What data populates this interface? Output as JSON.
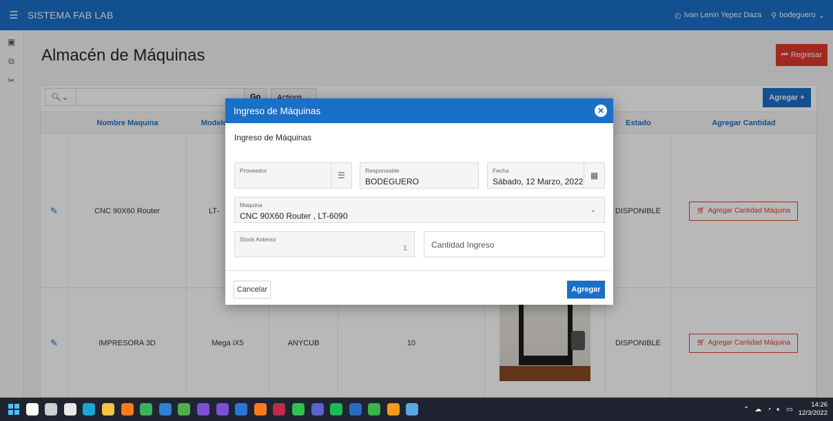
{
  "app": {
    "title": "SISTEMA FAB LAB",
    "user_full": "Ivan Lenin Yepez Daza",
    "user_name": "bodeguero"
  },
  "page": {
    "title": "Almacén de Máquinas",
    "back_label": "Regresar"
  },
  "report": {
    "go_label": "Go",
    "actions_label": "Actions",
    "add_label": "Agregar",
    "columns": [
      "Nombre Maquina",
      "Modelo",
      "Estado",
      "Agregar Cantidad"
    ],
    "rows": [
      {
        "name": "CNC 90X60 Router",
        "model": "LT-",
        "brand": "",
        "stock": "",
        "status": "DISPONIBLE",
        "action": "Agregar Cantidad Máquina"
      },
      {
        "name": "IMPRESORA 3D",
        "model": "Mega iX5",
        "brand": "ANYCUB",
        "stock": "10",
        "status": "DISPONIBLE",
        "action": "Agregar Cantidad Máquina"
      }
    ]
  },
  "modal": {
    "title": "Ingreso de Máquinas",
    "subtitle": "Ingreso de Máquinas",
    "proveedor_label": "Proveedor",
    "proveedor_value": "",
    "responsable_label": "Responsable",
    "responsable_value": "BODEGUERO",
    "fecha_label": "Fecha",
    "fecha_value": "Sábado, 12 Marzo, 2022",
    "maquina_label": "Maquina",
    "maquina_value": "CNC 90X60 Router , LT-6090",
    "stock_label": "Stock Anterior",
    "stock_value": "1",
    "cantidad_placeholder": "Cantidad Ingreso",
    "cancel_label": "Cancelar",
    "submit_label": "Agregar"
  },
  "taskbar": {
    "time": "14:26",
    "date": "12/3/2022",
    "icons": [
      {
        "name": "search",
        "color": "#ffffff"
      },
      {
        "name": "task-view",
        "color": "#cfcfcf"
      },
      {
        "name": "onedrive",
        "color": "#e9e9e9"
      },
      {
        "name": "edge",
        "color": "#1fa3d8"
      },
      {
        "name": "file-explorer",
        "color": "#f6c342"
      },
      {
        "name": "firefox",
        "color": "#ff7a1a"
      },
      {
        "name": "photos",
        "color": "#38b35a"
      },
      {
        "name": "lite",
        "color": "#2f80d6"
      },
      {
        "name": "visio",
        "color": "#4fb04a"
      },
      {
        "name": "vs",
        "color": "#7b4fd6"
      },
      {
        "name": "vscode",
        "color": "#7b4fd6"
      },
      {
        "name": "virtualbox",
        "color": "#2a78d6"
      },
      {
        "name": "illustrator",
        "color": "#ff7a1a"
      },
      {
        "name": "mendeley",
        "color": "#c22b4b"
      },
      {
        "name": "whatsapp",
        "color": "#2fc24c"
      },
      {
        "name": "teams",
        "color": "#5b62c9"
      },
      {
        "name": "spotify",
        "color": "#1db954"
      },
      {
        "name": "word",
        "color": "#2b6ac4"
      },
      {
        "name": "app-green",
        "color": "#3bb34a"
      },
      {
        "name": "app-orange",
        "color": "#f39b1c"
      },
      {
        "name": "app-globe",
        "color": "#5aa9e6"
      }
    ]
  },
  "colors": {
    "primary": "#1a6fc6",
    "danger": "#e0392e"
  }
}
